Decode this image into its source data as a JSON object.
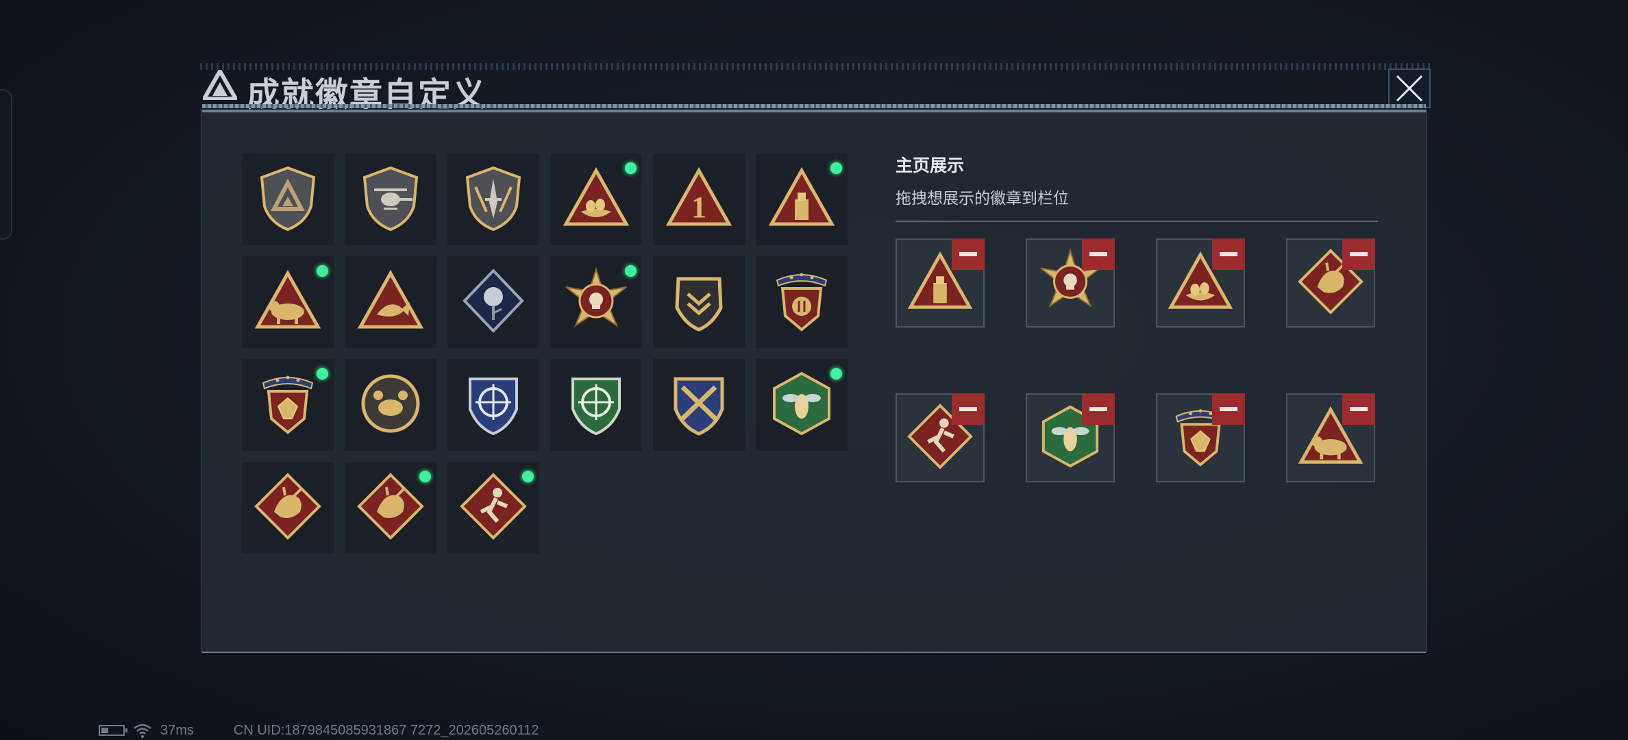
{
  "header": {
    "title": "成就徽章自定义"
  },
  "icons": {
    "logo": "delta-triangle-logo-icon",
    "close": "close-x-icon",
    "owned": "green-dot-icon",
    "remove": "minus-icon",
    "battery": "battery-icon",
    "wifi": "wifi-icon"
  },
  "colors": {
    "owned_dot": "#3ff0a0",
    "remove_button": "#9c2b2d",
    "panel_bg": "#222932"
  },
  "badges": [
    {
      "name": "delta-shield-badge",
      "owned": false
    },
    {
      "name": "helicopter-shield-badge",
      "owned": false
    },
    {
      "name": "dagger-shield-badge",
      "owned": false
    },
    {
      "name": "egg-nest-triangle-badge",
      "owned": true
    },
    {
      "name": "number-one-triangle-badge",
      "owned": false
    },
    {
      "name": "usb-drive-triangle-badge",
      "owned": true
    },
    {
      "name": "hippo-triangle-badge",
      "owned": true
    },
    {
      "name": "fish-triangle-badge",
      "owned": false
    },
    {
      "name": "rose-diamond-badge",
      "owned": false
    },
    {
      "name": "skull-compass-badge",
      "owned": true
    },
    {
      "name": "chevron-shield-badge",
      "owned": false
    },
    {
      "name": "blue-ribbon-crest-badge",
      "owned": false
    },
    {
      "name": "gem-ribbon-crest-badge",
      "owned": true
    },
    {
      "name": "crab-round-badge",
      "owned": false
    },
    {
      "name": "blue-crosshair-badge",
      "owned": false
    },
    {
      "name": "green-crosshair-badge",
      "owned": false
    },
    {
      "name": "crossed-weapons-badge",
      "owned": false
    },
    {
      "name": "wasp-hexagon-badge",
      "owned": true
    },
    {
      "name": "dragon-diamond-badge",
      "owned": false
    },
    {
      "name": "dragon-diamond-badge-2",
      "owned": true
    },
    {
      "name": "runner-diamond-badge",
      "owned": true
    }
  ],
  "showcase": {
    "title": "主页展示",
    "hint": "拖拽想展示的徽章到栏位",
    "slots": [
      {
        "badge": "usb-drive-triangle-badge"
      },
      {
        "badge": "skull-compass-badge"
      },
      {
        "badge": "egg-nest-triangle-badge"
      },
      {
        "badge": "dragon-diamond-badge"
      },
      {
        "badge": "runner-diamond-badge"
      },
      {
        "badge": "wasp-hexagon-badge"
      },
      {
        "badge": "gem-ribbon-crest-badge"
      },
      {
        "badge": "hippo-triangle-badge"
      }
    ]
  },
  "status": {
    "ping": "37ms",
    "uid": "CN UID:1879845085931867 7272_202605260112"
  }
}
